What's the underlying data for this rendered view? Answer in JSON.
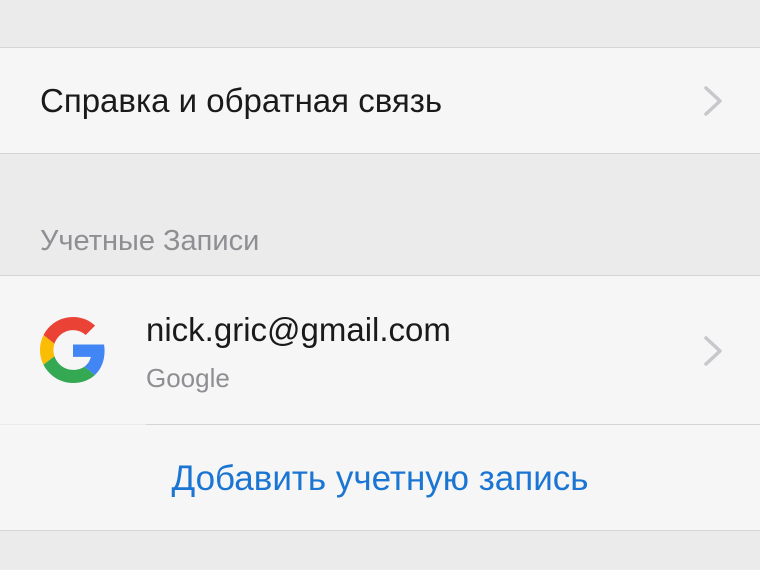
{
  "help": {
    "label": "Справка и обратная связь"
  },
  "accounts": {
    "section_title": "Учетные Записи",
    "items": [
      {
        "email": "nick.gric@gmail.com",
        "provider": "Google",
        "icon": "google-logo"
      }
    ],
    "add_account_label": "Добавить учетную запись"
  },
  "colors": {
    "background": "#ebebeb",
    "cell_background": "#f6f6f6",
    "primary_text": "#1a1a1a",
    "secondary_text": "#8e8e93",
    "link": "#1a76d2",
    "chevron": "#c7c7cc"
  }
}
